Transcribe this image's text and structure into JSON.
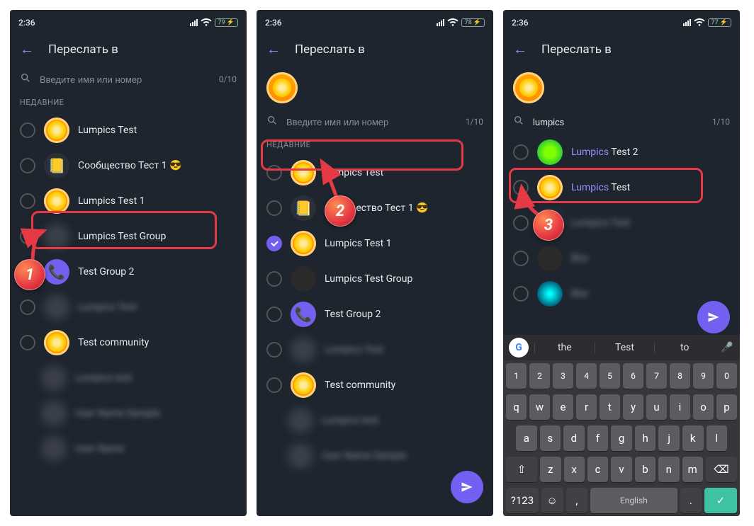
{
  "status": {
    "time": "2:36",
    "battery_1": "79",
    "battery_2": "78",
    "battery_3": "77"
  },
  "header": {
    "title": "Переслать в"
  },
  "search": {
    "placeholder": "Введите имя или номер",
    "icon": "search-icon"
  },
  "section": {
    "recent": "НЕДАВНИЕ"
  },
  "counts": {
    "s1": "0/10",
    "s2": "1/10",
    "s3": "1/10"
  },
  "screen1": {
    "items": [
      {
        "label": "Lumpics Test",
        "avatar": "lemon"
      },
      {
        "label": "Сообщество Тест 1 😎",
        "avatar": "comm"
      },
      {
        "label": "Lumpics Test 1",
        "avatar": "lemon",
        "highlighted": true
      },
      {
        "label": "Lumpics Test Group",
        "avatar": "blur",
        "blurAvatar": true
      },
      {
        "label": "Test Group 2",
        "avatar": "viber"
      },
      {
        "label": "Lumpics Test",
        "avatar": "blur",
        "blurAll": true
      },
      {
        "label": "Test community",
        "avatar": "lemon"
      },
      {
        "label": "Lumpics test",
        "avatar": "blur",
        "blurAll": true,
        "noRadio": true
      },
      {
        "label": "User Name Sample",
        "avatar": "blur",
        "blurAll": true,
        "noRadio": true
      },
      {
        "label": "User Name",
        "avatar": "blur",
        "blurAll": true,
        "noRadio": true
      }
    ]
  },
  "screen2": {
    "items": [
      {
        "label": "Lumpics Test",
        "avatar": "lemon"
      },
      {
        "label": "Сообщество Тест 1 😎",
        "avatar": "comm"
      },
      {
        "label": "Lumpics Test 1",
        "avatar": "lemon",
        "checked": true
      },
      {
        "label": "Lumpics Test Group",
        "avatar": "dark"
      },
      {
        "label": "Test Group 2",
        "avatar": "viber"
      },
      {
        "label": "Lumpics Test",
        "avatar": "blur",
        "blurAll": true
      },
      {
        "label": "Test community",
        "avatar": "lemon"
      },
      {
        "label": "Lumpics test",
        "avatar": "blur",
        "blurAll": true,
        "noRadio": true
      },
      {
        "label": "User Name Sample",
        "avatar": "blur",
        "blurAll": true,
        "noRadio": true
      }
    ]
  },
  "screen3": {
    "search_value": "lumpics",
    "items": [
      {
        "prefix": "Lumpics",
        "suffix": " Test 2",
        "avatar": "green",
        "highlighted": true
      },
      {
        "prefix": "Lumpics",
        "suffix": " Test",
        "avatar": "lemon"
      },
      {
        "label": "Lumpics Test",
        "avatar": "blur",
        "blurAll": true
      },
      {
        "label": "Blur",
        "avatar": "dark",
        "blurAll": true
      },
      {
        "label": "Blur",
        "avatar": "glow",
        "blurAll": true
      }
    ]
  },
  "keyboard": {
    "suggestions": [
      "the",
      "Test",
      "to"
    ],
    "row_nums": [
      "1",
      "2",
      "3",
      "4",
      "5",
      "6",
      "7",
      "8",
      "9",
      "0"
    ],
    "row1": [
      "q",
      "w",
      "e",
      "r",
      "t",
      "y",
      "u",
      "i",
      "o",
      "p"
    ],
    "row2": [
      "a",
      "s",
      "d",
      "f",
      "g",
      "h",
      "j",
      "k",
      "l"
    ],
    "row3": [
      "z",
      "x",
      "c",
      "v",
      "b",
      "n",
      "m"
    ],
    "shift": "⇧",
    "backspace": "⌫",
    "symbols": "?123",
    "emoji": "☺",
    "comma": ",",
    "space": "English",
    "period": ".",
    "enter": "✓"
  },
  "steps": {
    "s1": "1",
    "s2": "2",
    "s3": "3"
  }
}
